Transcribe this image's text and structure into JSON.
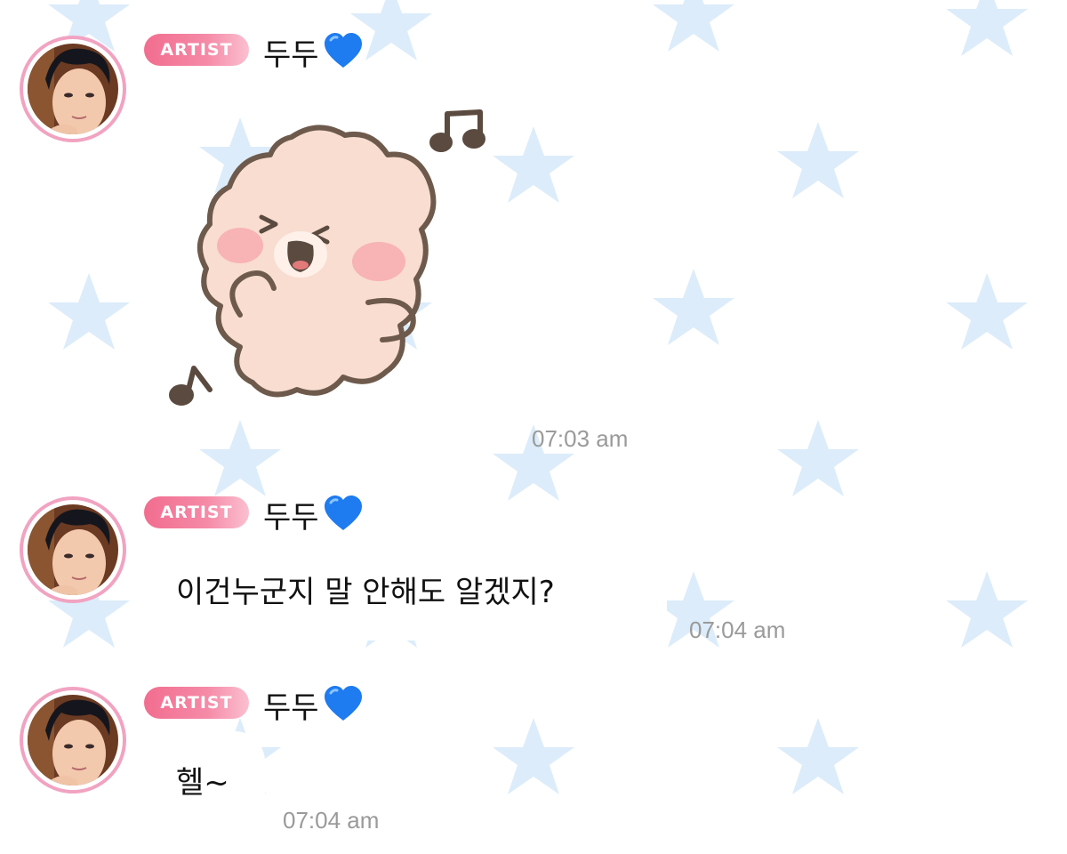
{
  "messages": [
    {
      "badge": "ARTIST",
      "sender": "두두",
      "type": "sticker",
      "sticker_icon": "dancing-blob-sticker",
      "time": "07:03 am"
    },
    {
      "badge": "ARTIST",
      "sender": "두두",
      "type": "text",
      "text": "이건누군지 말 안해도 알겠지?",
      "time": "07:04 am"
    },
    {
      "badge": "ARTIST",
      "sender": "두두",
      "type": "text",
      "text": "헬~",
      "time": "07:04 am"
    }
  ],
  "colors": {
    "badge_pink": "#f26d8f",
    "avatar_ring": "#f1a3c1",
    "heart_blue": "#1e7bf0",
    "star_blue": "#dcecfa",
    "timestamp_gray": "#9a9a9a"
  },
  "icons": {
    "heart": "blue-heart-icon",
    "background": "star-pattern"
  }
}
